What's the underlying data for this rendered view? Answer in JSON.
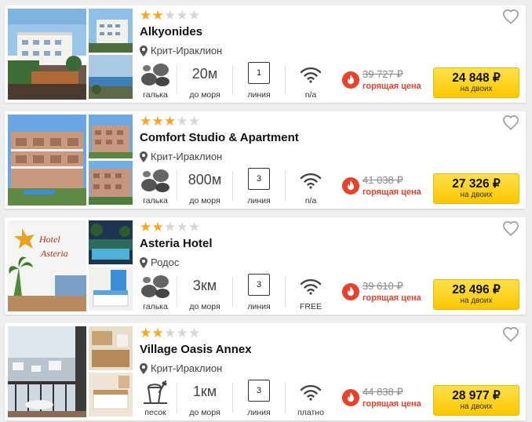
{
  "colors": {
    "accent_yellow": "#fcc700",
    "hot_red": "#e8412c",
    "star_on": "#f5a623",
    "star_off": "#d6d6d6"
  },
  "icons": {
    "favorite": "heart-outline-icon",
    "location": "map-pin-icon",
    "beach_pebble": "pebbles-icon",
    "beach_sand": "sand-bucket-icon",
    "wifi": "wifi-icon",
    "hot": "flame-icon"
  },
  "hotels": [
    {
      "stars": 2,
      "name": "Alkyonides",
      "location": "Крит-Ираклион",
      "beach_label": "галька",
      "beach_type": "pebble",
      "distance": "20м",
      "distance_label": "до моря",
      "line": "1",
      "line_label": "линия",
      "wifi_label": "n/a",
      "old_price": "39 727 ₽",
      "hot_label": "горящая цена",
      "price": "24 848 ₽",
      "price_sub": "на двоих"
    },
    {
      "stars": 3,
      "name": "Comfort Studio & Apartment",
      "location": "Крит-Ираклион",
      "beach_label": "галька",
      "beach_type": "pebble",
      "distance": "800м",
      "distance_label": "до моря",
      "line": "3",
      "line_label": "линия",
      "wifi_label": "n/a",
      "old_price": "41 038 ₽",
      "hot_label": "горящая цена",
      "price": "27 326 ₽",
      "price_sub": "на двоих"
    },
    {
      "stars": 2,
      "name": "Asteria Hotel",
      "location": "Родос",
      "beach_label": "галька",
      "beach_type": "pebble",
      "distance": "3км",
      "distance_label": "до моря",
      "line": "3",
      "line_label": "линия",
      "wifi_label": "FREE",
      "old_price": "39 610 ₽",
      "hot_label": "горящая цена",
      "price": "28 496 ₽",
      "price_sub": "на двоих"
    },
    {
      "stars": 2,
      "name": "Village Oasis Annex",
      "location": "Крит-Ираклион",
      "beach_label": "песок",
      "beach_type": "sand",
      "distance": "1км",
      "distance_label": "до моря",
      "line": "3",
      "line_label": "линия",
      "wifi_label": "платно",
      "old_price": "44 838 ₽",
      "hot_label": "горящая цена",
      "price": "28 977 ₽",
      "price_sub": "на двоих"
    }
  ]
}
